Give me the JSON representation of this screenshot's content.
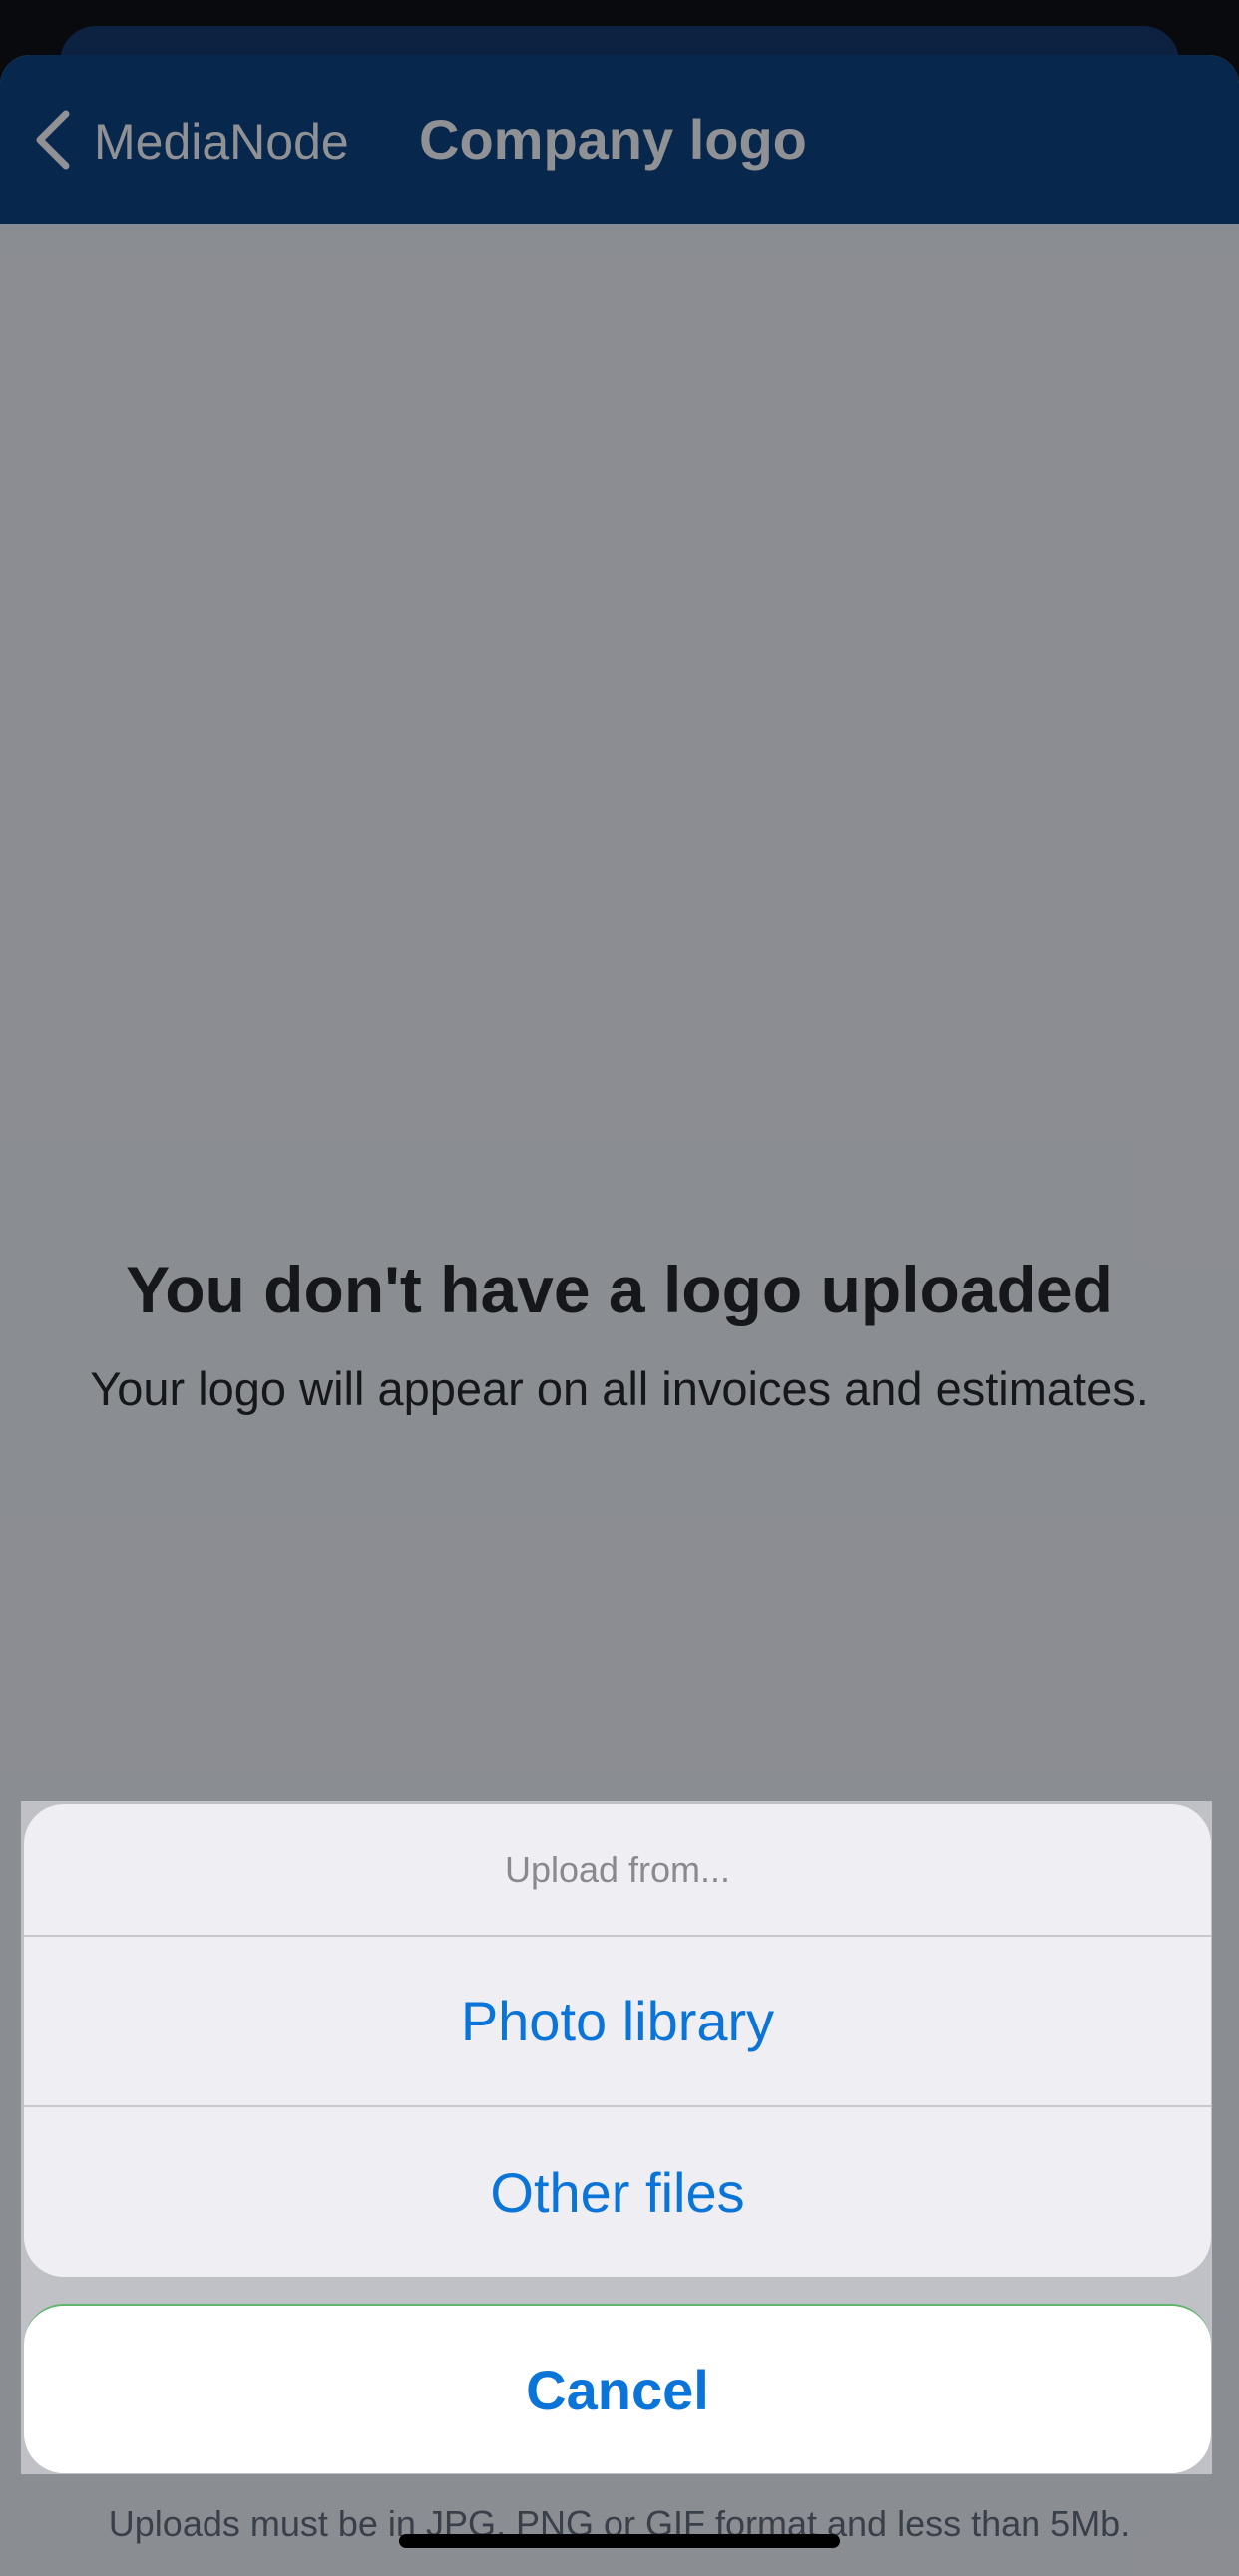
{
  "navbar": {
    "back_label": "MediaNode",
    "title": "Company logo"
  },
  "empty_state": {
    "title": "You don't have a logo uploaded",
    "subtitle": "Your logo will appear on all invoices and estimates."
  },
  "upload_hint": "Uploads must be in JPG, PNG or GIF format and less than 5Mb.",
  "action_sheet": {
    "header": "Upload from...",
    "items": [
      {
        "label": "Photo library"
      },
      {
        "label": "Other files"
      }
    ],
    "cancel_label": "Cancel"
  },
  "colors": {
    "navbar": "#003876",
    "action_text": "#0a74d8"
  }
}
